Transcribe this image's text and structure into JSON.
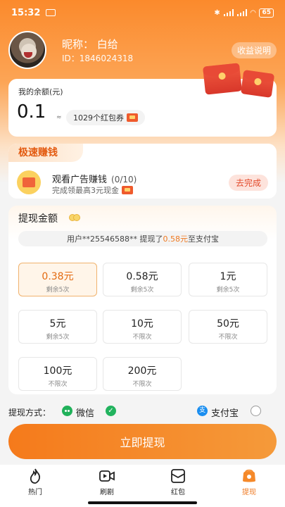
{
  "status_bar": {
    "time": "15:32",
    "battery": "65"
  },
  "profile": {
    "nickname": "昵称： 白给",
    "user_id": "ID：1846024318",
    "explain_button": "收益说明"
  },
  "balance": {
    "label": "我的余额(元)",
    "value": "0.1",
    "approx": "≈",
    "coupons": "1029个红包券"
  },
  "quick_earn": {
    "tag": "极速赚钱",
    "task_title": "观看广告赚钱",
    "task_progress": "(0/10)",
    "task_sub": "完成领最高3元现金",
    "action_button": "去完成"
  },
  "withdraw": {
    "title": "提现金额",
    "notice_prefix": "用户**25546588** 提现了",
    "notice_amount": "0.58元",
    "notice_suffix": "至支付宝",
    "selected_amount": "0.38元",
    "options": [
      {
        "amount": "0.38元",
        "remaining": "剩余5次"
      },
      {
        "amount": "0.58元",
        "remaining": "剩余5次"
      },
      {
        "amount": "1元",
        "remaining": "剩余5次"
      },
      {
        "amount": "5元",
        "remaining": "剩余5次"
      },
      {
        "amount": "10元",
        "remaining": "不限次"
      },
      {
        "amount": "50元",
        "remaining": "不限次"
      },
      {
        "amount": "100元",
        "remaining": "不限次"
      },
      {
        "amount": "200元",
        "remaining": "不限次"
      }
    ]
  },
  "payment": {
    "label": "提现方式：",
    "wechat": "微信",
    "alipay": "支付宝",
    "alipay_glyph": "支",
    "selected": "微信"
  },
  "submit_button": "立即提现",
  "tabs": [
    {
      "label": "热门",
      "icon": "flame-icon"
    },
    {
      "label": "刷剧",
      "icon": "video-icon"
    },
    {
      "label": "红包",
      "icon": "red-envelope-icon"
    },
    {
      "label": "提现",
      "icon": "wallet-icon"
    }
  ],
  "active_tab": "提现",
  "colors": {
    "accent": "#f57a1b",
    "highlight": "#ef7a22",
    "wechat": "#22b35e",
    "alipay": "#1a8ef0"
  }
}
